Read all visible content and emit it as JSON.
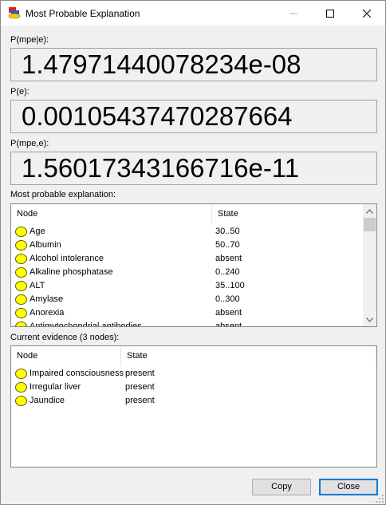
{
  "window": {
    "title": "Most Probable Explanation"
  },
  "fields": {
    "p_mpe_e": {
      "label": "P(mpe|e):",
      "value": "1.47971440078234e-08"
    },
    "p_e": {
      "label": "P(e):",
      "value": "0.00105437470287664"
    },
    "p_mpe_and_e": {
      "label": "P(mpe,e):",
      "value": "1.56017343166716e-11"
    }
  },
  "mpe": {
    "label": "Most probable explanation:",
    "columns": {
      "node": "Node",
      "state": "State"
    },
    "rows": [
      {
        "node": "Age",
        "state": "30..50"
      },
      {
        "node": "Albumin",
        "state": "50..70"
      },
      {
        "node": "Alcohol intolerance",
        "state": "absent"
      },
      {
        "node": "Alkaline phosphatase",
        "state": "0..240"
      },
      {
        "node": "ALT",
        "state": "35..100"
      },
      {
        "node": "Amylase",
        "state": "0..300"
      },
      {
        "node": "Anorexia",
        "state": "absent"
      },
      {
        "node": "Antimytochondrial antibodies",
        "state": "absent"
      }
    ],
    "scroll_position": 0.0
  },
  "evidence": {
    "label": "Current evidence (3 nodes):",
    "columns": {
      "node": "Node",
      "state": "State"
    },
    "rows": [
      {
        "node": "Impaired consciousness",
        "state": "present"
      },
      {
        "node": "Irregular liver",
        "state": "present"
      },
      {
        "node": "Jaundice",
        "state": "present"
      }
    ]
  },
  "buttons": {
    "copy": "Copy",
    "close": "Close"
  },
  "colors": {
    "node_fill": "#ffff00",
    "accent": "#0078d7"
  }
}
